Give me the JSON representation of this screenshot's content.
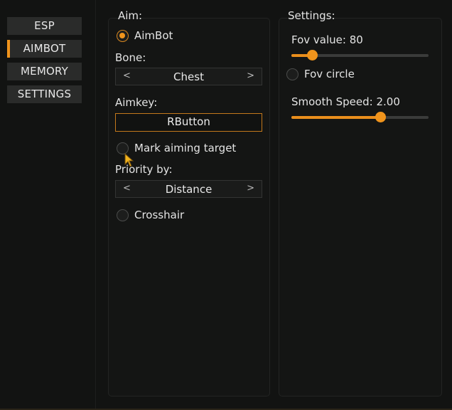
{
  "nav": {
    "items": [
      {
        "label": "ESP",
        "active": false
      },
      {
        "label": "AIMBOT",
        "active": true
      },
      {
        "label": "MEMORY",
        "active": false
      },
      {
        "label": "SETTINGS",
        "active": false
      }
    ]
  },
  "aim": {
    "section_title": "Aim:",
    "aimbot_label": "AimBot",
    "aimbot_enabled": true,
    "bone_label": "Bone:",
    "bone_value": "Chest",
    "arrow_left": "<",
    "arrow_right": ">",
    "aimkey_label": "Aimkey:",
    "aimkey_value": "RButton",
    "mark_target_label": "Mark aiming target",
    "mark_target_enabled": false,
    "priority_label": "Priority by:",
    "priority_value": "Distance",
    "crosshair_label": "Crosshair",
    "crosshair_enabled": false
  },
  "settings": {
    "section_title": "Settings:",
    "fov_label": "Fov value: 80",
    "fov_value": 80,
    "fov_fraction": 0.15,
    "fov_circle_label": "Fov circle",
    "fov_circle_enabled": false,
    "smooth_label": "Smooth Speed: 2.00",
    "smooth_value": 2.0,
    "smooth_fraction": 0.65
  },
  "colors": {
    "accent": "#f0941c",
    "background": "#121312",
    "button": "#2a2b2a"
  }
}
